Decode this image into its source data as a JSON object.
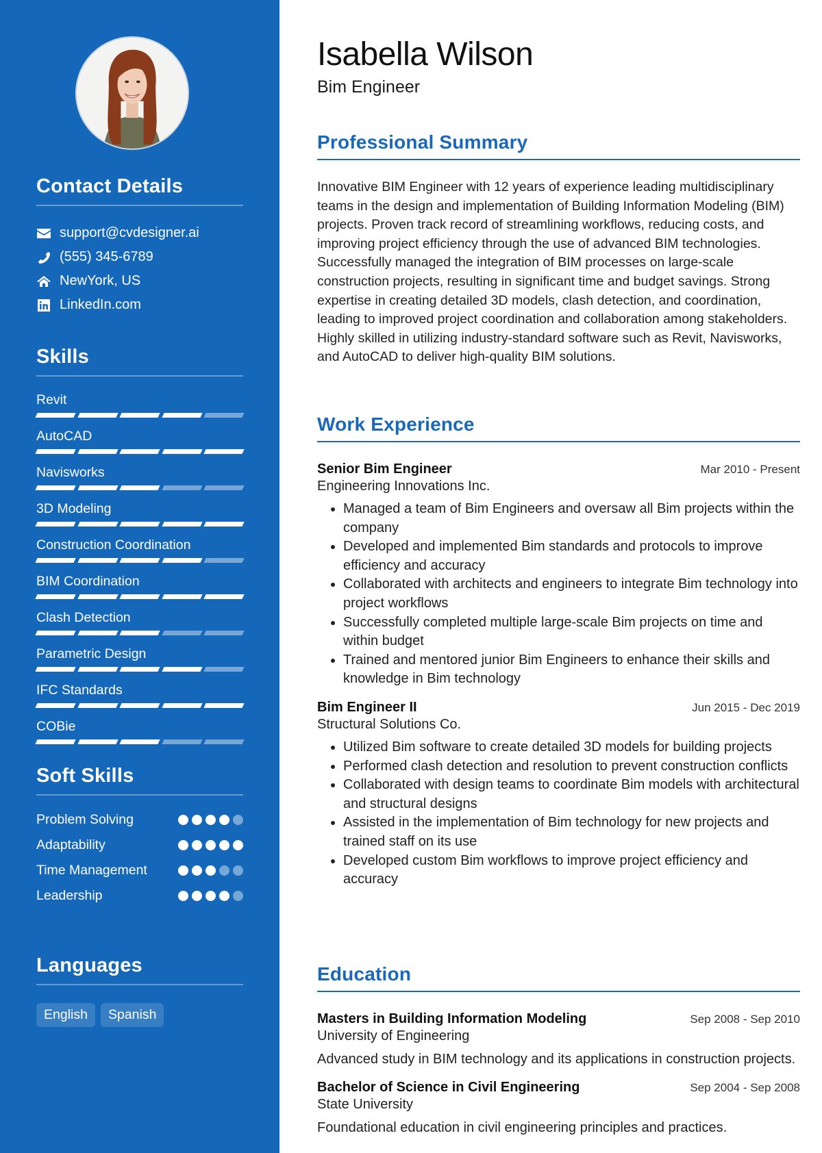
{
  "profile": {
    "name": "Isabella Wilson",
    "role": "Bim Engineer",
    "photo_alt": "profile-photo"
  },
  "colors": {
    "sidebar": "#1568b9",
    "accent": "#1a68ba",
    "text": "#222222"
  },
  "sidebar": {
    "contact": {
      "title": "Contact Details",
      "items": [
        {
          "icon": "envelope-icon",
          "text": "support@cvdesigner.ai"
        },
        {
          "icon": "phone-icon",
          "text": "(555) 345-6789"
        },
        {
          "icon": "home-icon",
          "text": "NewYork, US"
        },
        {
          "icon": "linkedin-icon",
          "text": "LinkedIn.com"
        }
      ]
    },
    "skills": {
      "title": "Skills",
      "max": 5,
      "items": [
        {
          "name": "Revit",
          "level": 4
        },
        {
          "name": "AutoCAD",
          "level": 5
        },
        {
          "name": "Navisworks",
          "level": 3
        },
        {
          "name": "3D Modeling",
          "level": 5
        },
        {
          "name": "Construction Coordination",
          "level": 4
        },
        {
          "name": "BIM Coordination",
          "level": 5
        },
        {
          "name": "Clash Detection",
          "level": 3
        },
        {
          "name": "Parametric Design",
          "level": 4
        },
        {
          "name": "IFC Standards",
          "level": 5
        },
        {
          "name": "COBie",
          "level": 3
        }
      ]
    },
    "soft_skills": {
      "title": "Soft Skills",
      "max": 5,
      "items": [
        {
          "name": "Problem Solving",
          "level": 4
        },
        {
          "name": "Adaptability",
          "level": 5
        },
        {
          "name": "Time Management",
          "level": 3
        },
        {
          "name": "Leadership",
          "level": 4
        }
      ]
    },
    "languages": {
      "title": "Languages",
      "items": [
        "English",
        "Spanish"
      ]
    }
  },
  "main": {
    "summary": {
      "title": "Professional Summary",
      "text": "Innovative BIM Engineer with 12 years of experience leading multidisciplinary teams in the design and implementation of Building Information Modeling (BIM) projects. Proven track record of streamlining workflows, reducing costs, and improving project efficiency through the use of advanced BIM technologies. Successfully managed the integration of BIM processes on large-scale construction projects, resulting in significant time and budget savings. Strong expertise in creating detailed 3D models, clash detection, and coordination, leading to improved project coordination and collaboration among stakeholders. Highly skilled in utilizing industry-standard software such as Revit, Navisworks, and AutoCAD to deliver high-quality BIM solutions."
    },
    "experience": {
      "title": "Work Experience",
      "jobs": [
        {
          "title": "Senior Bim Engineer",
          "date": "Mar 2010 - Present",
          "company": "Engineering Innovations Inc.",
          "bullets": [
            "Managed a team of Bim Engineers and oversaw all Bim projects within the company",
            "Developed and implemented Bim standards and protocols to improve efficiency and accuracy",
            "Collaborated with architects and engineers to integrate Bim technology into project workflows",
            "Successfully completed multiple large-scale Bim projects on time and within budget",
            "Trained and mentored junior Bim Engineers to enhance their skills and knowledge in Bim technology"
          ]
        },
        {
          "title": "Bim Engineer II",
          "date": "Jun 2015 - Dec 2019",
          "company": "Structural Solutions Co.",
          "bullets": [
            "Utilized Bim software to create detailed 3D models for building projects",
            "Performed clash detection and resolution to prevent construction conflicts",
            "Collaborated with design teams to coordinate Bim models with architectural and structural designs",
            "Assisted in the implementation of Bim technology for new projects and trained staff on its use",
            "Developed custom Bim workflows to improve project efficiency and accuracy"
          ]
        }
      ]
    },
    "education": {
      "title": "Education",
      "items": [
        {
          "degree": "Masters in Building Information Modeling",
          "date": "Sep 2008 - Sep 2010",
          "school": "University of Engineering",
          "description": "Advanced study in BIM technology and its applications in construction projects."
        },
        {
          "degree": "Bachelor of Science in Civil Engineering",
          "date": "Sep 2004 - Sep 2008",
          "school": "State University",
          "description": "Foundational education in civil engineering principles and practices."
        }
      ]
    }
  }
}
